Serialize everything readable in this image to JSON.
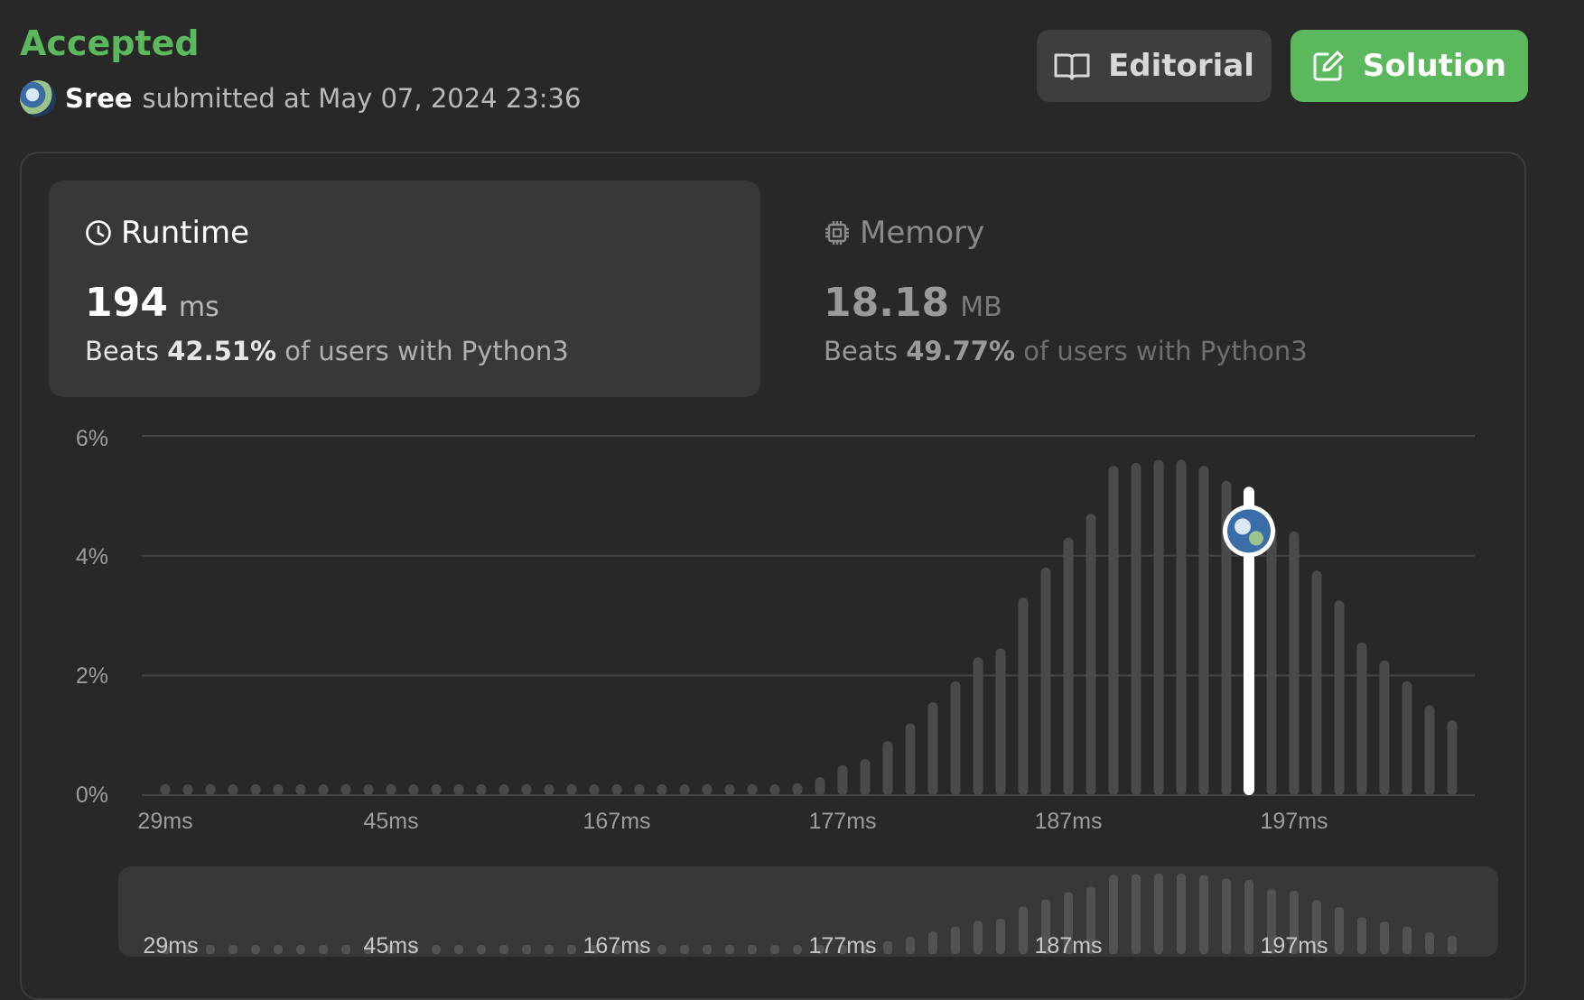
{
  "header": {
    "status": "Accepted",
    "username": "Sree",
    "submitted_text": "submitted at May 07, 2024 23:36",
    "editorial_label": "Editorial",
    "solution_label": "Solution",
    "avatar_icon": "user-avatar",
    "editorial_icon": "book-open-icon",
    "solution_icon": "edit-icon"
  },
  "runtime": {
    "title": "Runtime",
    "icon": "clock-icon",
    "value": "194",
    "unit": "ms",
    "beats_word": "Beats",
    "beats_pct": "42.51%",
    "beats_rest": "of users with Python3"
  },
  "memory": {
    "title": "Memory",
    "icon": "cpu-chip-icon",
    "value": "18.18",
    "unit": "MB",
    "beats_word": "Beats",
    "beats_pct": "49.77%",
    "beats_rest": "of users with Python3"
  },
  "colors": {
    "accepted_green": "#5cb85c",
    "bar": "#4a4a4a",
    "marker": "#ffffff",
    "grid": "#444444"
  },
  "chart_data": {
    "type": "bar",
    "y_tick_labels": [
      "6%",
      "4%",
      "2%",
      "0%"
    ],
    "y_ticks": [
      6,
      4,
      2,
      0
    ],
    "ylim": [
      0,
      6
    ],
    "x_tick_labels": [
      "29ms",
      "45ms",
      "167ms",
      "177ms",
      "187ms",
      "197ms"
    ],
    "x_tick_bar_index": [
      0,
      10,
      20,
      30,
      40,
      50
    ],
    "values": [
      0.15,
      0.15,
      0.15,
      0.15,
      0.15,
      0.15,
      0.15,
      0.15,
      0.15,
      0.15,
      0.15,
      0.15,
      0.15,
      0.15,
      0.15,
      0.15,
      0.15,
      0.15,
      0.15,
      0.15,
      0.15,
      0.15,
      0.15,
      0.15,
      0.15,
      0.15,
      0.15,
      0.15,
      0.2,
      0.3,
      0.5,
      0.6,
      0.9,
      1.2,
      1.55,
      1.9,
      2.3,
      2.45,
      3.3,
      3.8,
      4.3,
      4.7,
      5.5,
      5.55,
      5.6,
      5.6,
      5.5,
      5.25,
      5.15,
      4.5,
      4.4,
      3.75,
      3.25,
      2.55,
      2.25,
      1.9,
      1.5,
      1.25
    ],
    "highlight_index": 48,
    "grid": true,
    "navigator_x_tick_labels": [
      "29ms",
      "45ms",
      "167ms",
      "177ms",
      "187ms",
      "197ms"
    ]
  }
}
